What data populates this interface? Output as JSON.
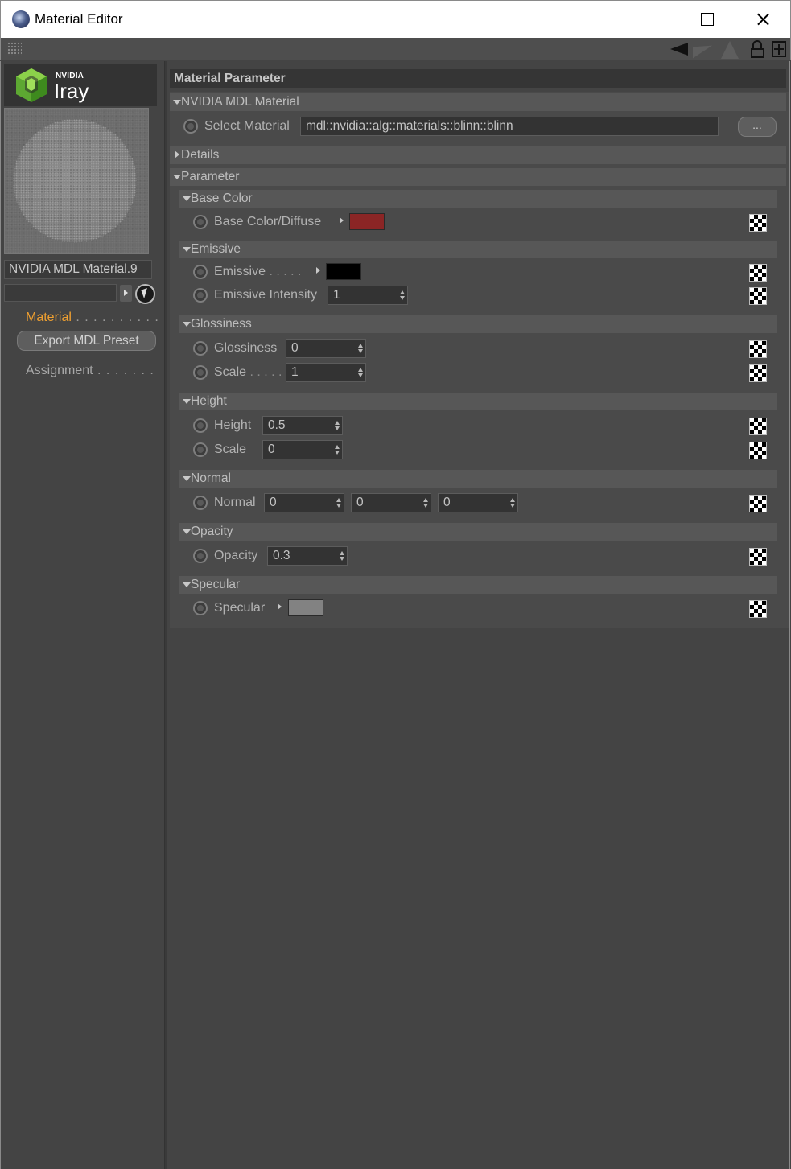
{
  "window": {
    "title": "Material Editor"
  },
  "sidebar": {
    "logo_top": "NVIDIA",
    "logo_bottom": "Iray",
    "material_name": "NVIDIA MDL Material.9",
    "nav_material": "Material",
    "nav_material_dots": " . . . . . . . . . .",
    "export_button": "Export MDL Preset",
    "nav_assignment": "Assignment",
    "nav_assignment_dots": " . . . . . . ."
  },
  "main": {
    "header": "Material Parameter",
    "mdl_group": "NVIDIA MDL Material",
    "select_material_label": "Select Material",
    "select_material_value": "mdl::nvidia::alg::materials::blinn::blinn",
    "browse_button": "...",
    "details_group": "Details",
    "parameter_group": "Parameter",
    "base_color": {
      "title": "Base Color",
      "diffuse_label": "Base Color/Diffuse",
      "diffuse_color": "#8b2525"
    },
    "emissive": {
      "title": "Emissive",
      "emissive_label": "Emissive",
      "emissive_dots": " . . . . .",
      "emissive_color": "#000000",
      "intensity_label": "Emissive Intensity",
      "intensity_value": "1"
    },
    "glossiness": {
      "title": "Glossiness",
      "glossiness_label": "Glossiness",
      "glossiness_value": "0",
      "scale_label": "Scale",
      "scale_dots": " . . . . .",
      "scale_value": "1"
    },
    "height": {
      "title": "Height",
      "height_label": "Height",
      "height_value": "0.5",
      "scale_label": "Scale",
      "scale_value": "0"
    },
    "normal": {
      "title": "Normal",
      "normal_label": "Normal",
      "x": "0",
      "y": "0",
      "z": "0"
    },
    "opacity": {
      "title": "Opacity",
      "opacity_label": "Opacity",
      "opacity_value": "0.3"
    },
    "specular": {
      "title": "Specular",
      "specular_label": "Specular",
      "specular_color": "#828282"
    }
  },
  "colors": {
    "accent_orange": "#f0a030",
    "panel_bg": "#444444"
  }
}
